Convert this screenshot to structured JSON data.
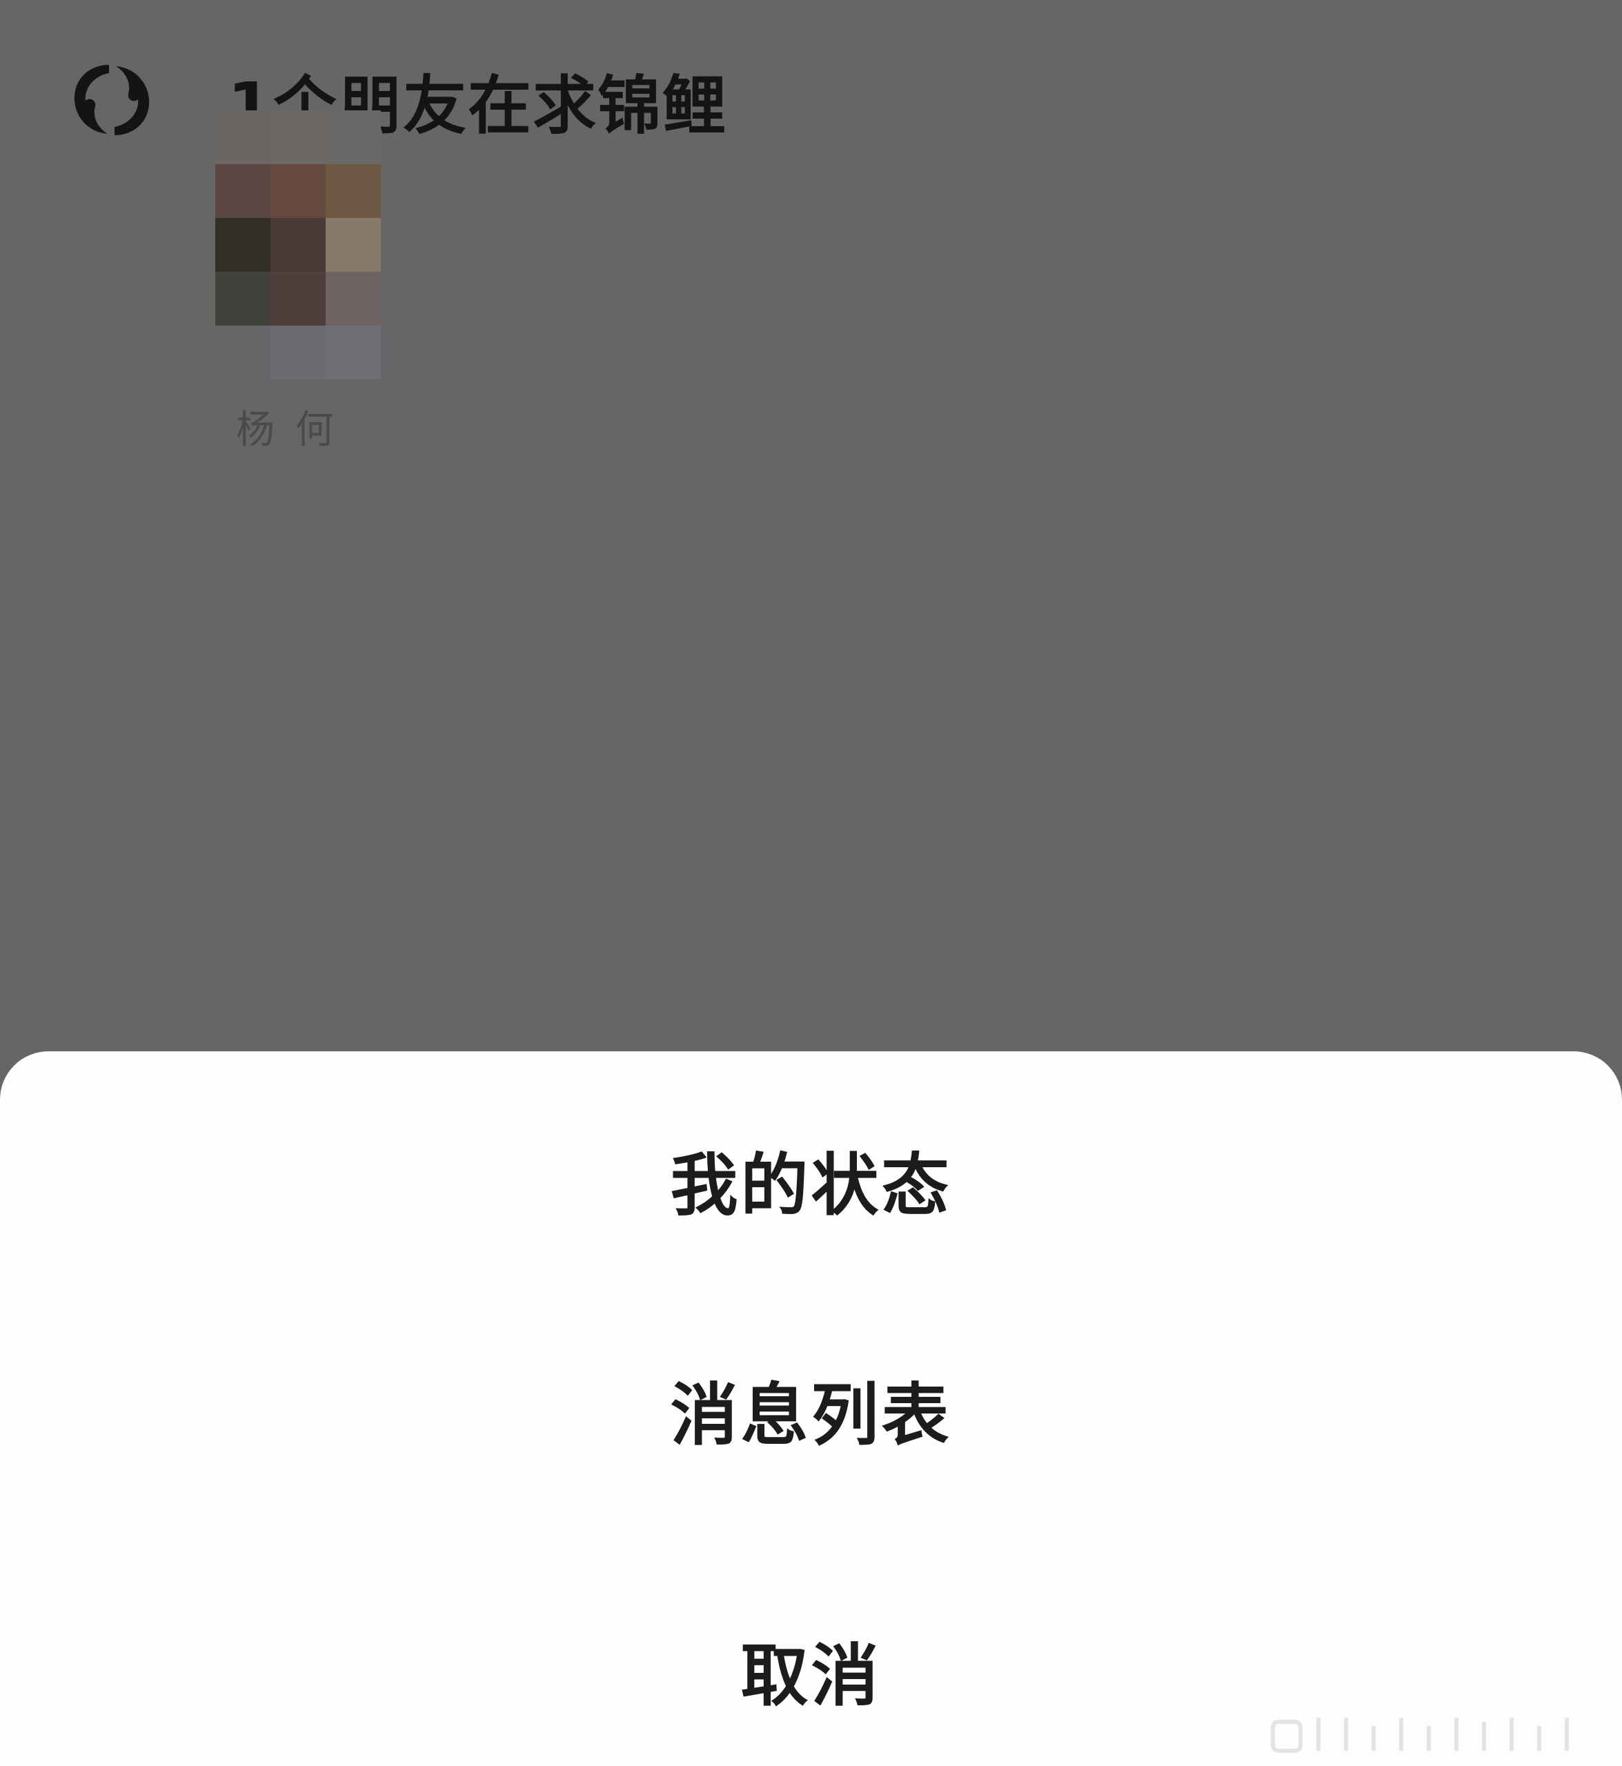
{
  "header": {
    "icon": "koi-fish-icon",
    "title": "1个朋友在求锦鲤"
  },
  "friend": {
    "name": "杨  何",
    "avatar_state": "pixelated"
  },
  "action_sheet": {
    "items": [
      {
        "label": "我的状态"
      },
      {
        "label": "消息列表"
      }
    ],
    "cancel_label": "取消"
  },
  "colors": {
    "overlay_background": "#666666",
    "sheet_background": "#fdfdfd",
    "text_primary": "#1c1c1c"
  }
}
